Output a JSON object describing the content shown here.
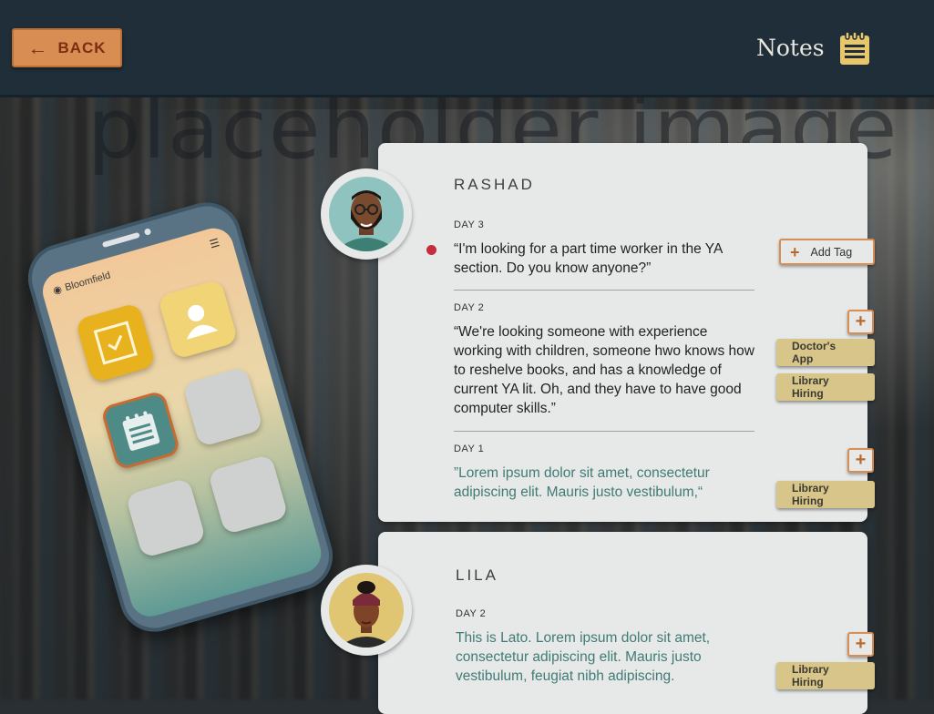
{
  "header": {
    "back_label": "BACK",
    "notes_title": "Notes"
  },
  "background": {
    "watermark": "placeholder image"
  },
  "phone": {
    "location": "Bloomfield"
  },
  "cards": [
    {
      "name": "RASHAD",
      "entries": [
        {
          "day": "DAY 3",
          "text": "“I'm looking for a part time worker in the YA section. Do you know anyone?”",
          "unread": true
        },
        {
          "day": "DAY 2",
          "text": "“We're looking someone with experience working with children, someone hwo knows how to reshelve books, and has a knowledge of current YA lit. Oh, and they have to have good computer skills.”"
        },
        {
          "day": "DAY 1",
          "text": "”Lorem ipsum dolor sit amet, consectetur adipiscing elit. Mauris justo vestibulum,“"
        }
      ]
    },
    {
      "name": "LILA",
      "entries": [
        {
          "day": "DAY 2",
          "text": "This is Lato. Lorem ipsum dolor sit amet, consectetur adipiscing elit. Mauris justo vestibulum, feugiat nibh adipiscing."
        }
      ]
    }
  ],
  "tags": {
    "add_tag_label": "Add Tag",
    "plus_symbol": "+",
    "day2_tags": [
      "Doctor's App",
      "Library Hiring"
    ],
    "day1_tags": [
      "Library Hiring"
    ],
    "lila_tags": [
      "Library Hiring"
    ]
  },
  "colors": {
    "accent_orange": "#d88d52",
    "tag_gold": "#d8c58a",
    "unread_dot": "#c62d3b",
    "header_bg": "#1f2e38"
  }
}
